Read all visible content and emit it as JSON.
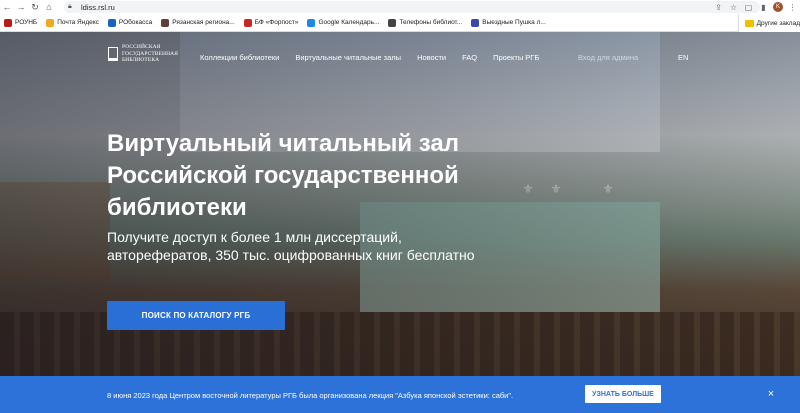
{
  "browser": {
    "url": "ldiss.rsl.ru",
    "bookmarks": [
      {
        "label": "РОУНБ",
        "color": "#b71c1c"
      },
      {
        "label": "Почта Яндекс",
        "color": "#f5a623"
      },
      {
        "label": "РОбокасса",
        "color": "#1565c0"
      },
      {
        "label": "Рязанская региона...",
        "color": "#5d4037"
      },
      {
        "label": "БФ «Форпост»",
        "color": "#c62828"
      },
      {
        "label": "Google Календарь...",
        "color": "#1e88e5"
      },
      {
        "label": "Телефоны библиот...",
        "color": "#424242"
      },
      {
        "label": "Выездные Пушка л...",
        "color": "#3949ab"
      }
    ],
    "other_bookmarks": "Другие заклад",
    "avatar_letter": "K"
  },
  "site": {
    "logo_text": "Российская\nгосударственная\nбиблиотека",
    "nav": [
      "Коллекции библиотеки",
      "Виртуальные читальные залы",
      "Новости",
      "FAQ",
      "Проекты РГБ"
    ],
    "login": "Вход для админа",
    "lang": "EN"
  },
  "hero": {
    "title": "Виртуальный читальный зал Российской государственной библиотеки",
    "subtitle": "Получите доступ к более 1 млн диссертаций, авторефератов, 350 тыс. оцифрованных книг бесплатно",
    "cta": "ПОИСК ПО КАТАЛОГУ РГБ"
  },
  "banner": {
    "text": "8 июня 2023 года Центром восточной литературы РГБ была организована лекция \"Азбука японской эстетики: саби\".",
    "button": "УЗНАТЬ БОЛЬШЕ",
    "close_icon": "×"
  }
}
